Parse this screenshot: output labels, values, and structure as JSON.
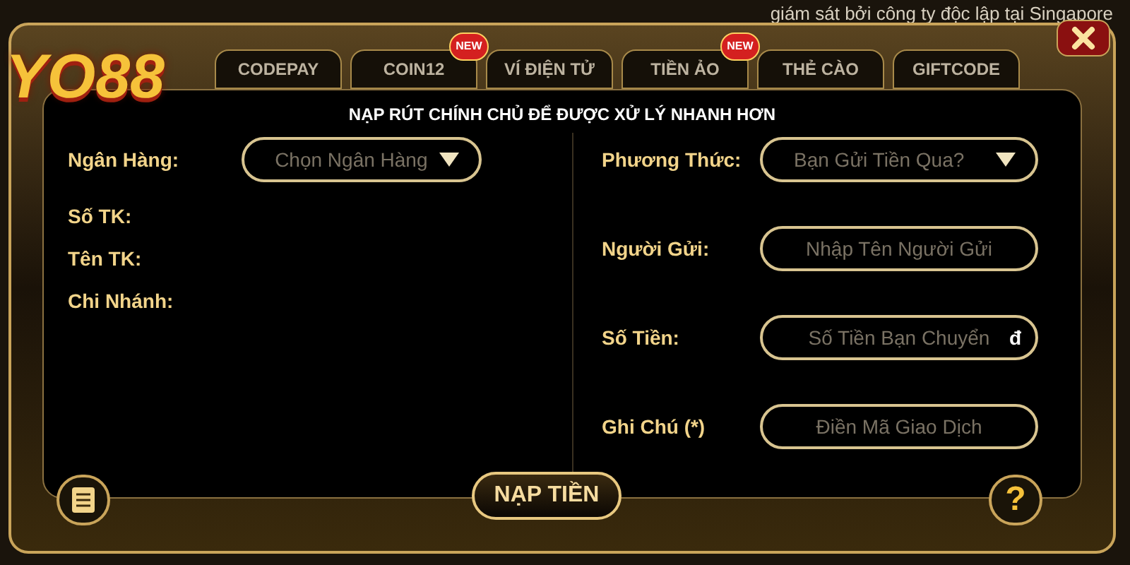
{
  "background": {
    "notice": "giám sát bởi công ty độc lập tại Singapore"
  },
  "logo": {
    "text": "YO88"
  },
  "tabs": [
    {
      "label": "CODEPAY",
      "selected": false
    },
    {
      "label": "COIN12",
      "selected": false,
      "badge": "NEW"
    },
    {
      "label": "VÍ ĐIỆN TỬ",
      "selected": false
    },
    {
      "label": "TIỀN ẢO",
      "selected": false,
      "badge": "NEW"
    },
    {
      "label": "THẺ CÀO",
      "selected": false
    },
    {
      "label": "GIFTCODE",
      "selected": false
    }
  ],
  "title": "NẠP RÚT CHÍNH CHỦ ĐỂ ĐƯỢC XỬ LÝ NHANH HƠN",
  "left_fields": [
    {
      "label": "Ngân Hàng:",
      "kind": "select",
      "placeholder": "Chọn Ngân Hàng"
    },
    {
      "label": "Số TK:",
      "kind": "info"
    },
    {
      "label": "Tên TK:",
      "kind": "info"
    },
    {
      "label": "Chi Nhánh:",
      "kind": "info"
    }
  ],
  "right_fields": [
    {
      "label": "Phương Thức:",
      "kind": "select",
      "placeholder": "Bạn Gửi Tiền Qua?"
    },
    {
      "label": "Người Gửi:",
      "kind": "input",
      "placeholder": "Nhập Tên Người Gửi"
    },
    {
      "label": "Số Tiền:",
      "kind": "input",
      "placeholder": "Số Tiền Bạn Chuyển",
      "suffix": "đ"
    },
    {
      "label": "Ghi Chú (*)",
      "kind": "input",
      "placeholder": "Điền Mã Giao Dịch"
    }
  ],
  "submit": "NẠP TIỀN",
  "help": "?"
}
